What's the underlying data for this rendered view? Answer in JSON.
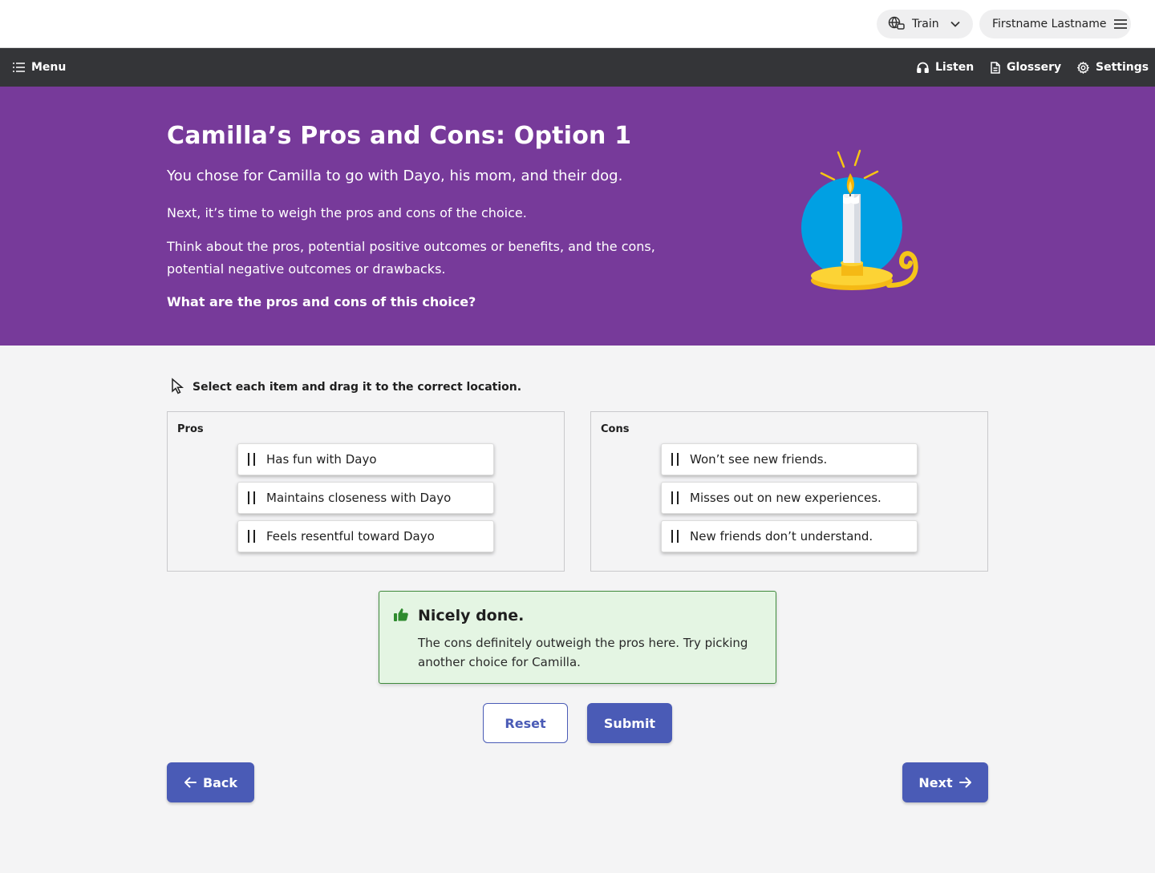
{
  "topbar": {
    "mode_label": "Train",
    "user_name": "Firstname Lastname"
  },
  "navbar": {
    "menu_label": "Menu",
    "listen_label": "Listen",
    "glossery_label": "Glossery",
    "settings_label": "Settings"
  },
  "hero": {
    "title": "Camilla’s Pros and Cons: Option 1",
    "paragraph1": "You chose for Camilla to go with Dayo, his mom, and their dog.",
    "paragraph2": "Next, it’s time to weigh the pros and cons of the choice.",
    "paragraph3": "Think about the pros, potential positive outcomes or benefits, and the cons, potential negative outcomes or drawbacks.",
    "question": "What are the pros and cons of this choice?",
    "illustration_icon": "candle-illustration"
  },
  "activity": {
    "instruction": "Select each item and drag it to the correct location.",
    "zones": [
      {
        "title": "Pros",
        "items": [
          "Has fun with Dayo",
          "Maintains closeness with Dayo",
          "Feels resentful toward Dayo"
        ]
      },
      {
        "title": "Cons",
        "items": [
          "Won’t see new friends.",
          "Misses out on new experiences.",
          "New friends don’t understand."
        ]
      }
    ]
  },
  "feedback": {
    "title": "Nicely done.",
    "text": "The cons definitely outweigh the pros here. Try picking another choice for Camilla.",
    "icon": "thumbs-up-icon"
  },
  "buttons": {
    "reset": "Reset",
    "submit": "Submit",
    "back": "Back",
    "next": "Next"
  },
  "colors": {
    "hero_bg": "#773a9a",
    "navbar_bg": "#343538",
    "primary": "#4a5bb6",
    "success_bg": "#e4f5e3",
    "success_border": "#3f8a3c"
  }
}
